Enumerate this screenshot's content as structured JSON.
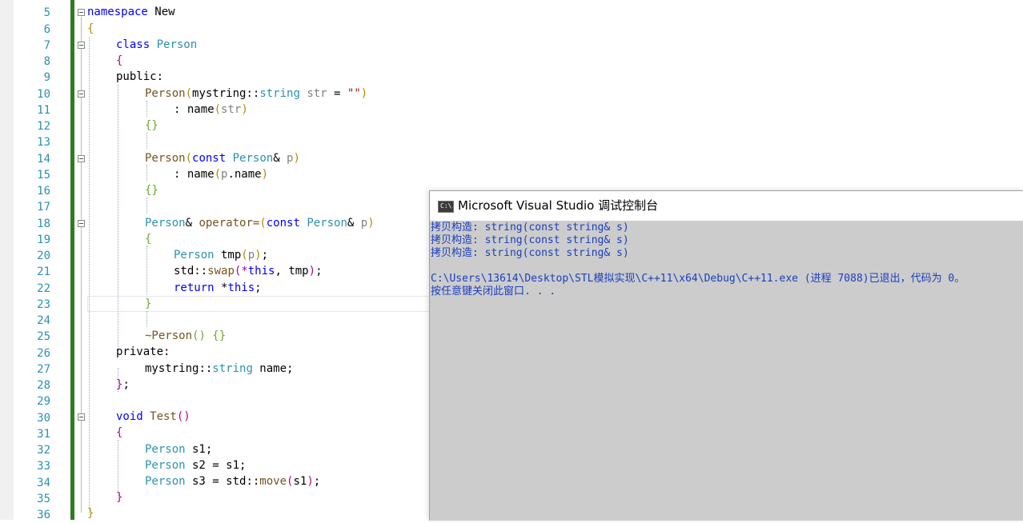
{
  "editor": {
    "line_numbers": [
      "5",
      "6",
      "7",
      "8",
      "9",
      "10",
      "11",
      "12",
      "13",
      "14",
      "15",
      "16",
      "17",
      "18",
      "19",
      "20",
      "21",
      "22",
      "23",
      "24",
      "25",
      "26",
      "27",
      "28",
      "29",
      "30",
      "31",
      "32",
      "33",
      "34",
      "35",
      "36"
    ],
    "code": {
      "l5_kw": "namespace",
      "l5_name": " New",
      "l6": "{",
      "l7_kw": "class",
      "l7_name": "Person",
      "l8": "{",
      "l9": "public:",
      "l10_fn": "Person",
      "l10_open": "(",
      "l10_ns": "mystring",
      "l10_sep": "::",
      "l10_ty": "string",
      "l10_param": " str",
      "l10_eq": " = ",
      "l10_str": "\"\"",
      "l10_close": ")",
      "l11_colon": ": name",
      "l11_open": "(",
      "l11_arg": "str",
      "l11_close": ")",
      "l12": "{}",
      "l14_fn": "Person",
      "l14_open": "(",
      "l14_kw": "const",
      "l14_ty": " Person",
      "l14_amp": "& ",
      "l14_p": "p",
      "l14_close": ")",
      "l15_colon": ": name",
      "l15_open": "(",
      "l15_arg": "p",
      "l15_dot": ".name",
      "l15_close": ")",
      "l16": "{}",
      "l18_ty": "Person",
      "l18_amp": "& ",
      "l18_op": "operator=",
      "l18_open": "(",
      "l18_kw": "const",
      "l18_ty2": " Person",
      "l18_amp2": "& ",
      "l18_p": "p",
      "l18_close": ")",
      "l19": "{",
      "l20_ty": "Person",
      "l20_var": " tmp",
      "l20_open": "(",
      "l20_p": "p",
      "l20_close": ")",
      "l20_semi": ";",
      "l21_ns": "std",
      "l21_sep": "::",
      "l21_fn": "swap",
      "l21_open": "(",
      "l21_star": "*",
      "l21_this": "this",
      "l21_comma": ", ",
      "l21_tmp": "tmp",
      "l21_close": ")",
      "l21_semi": ";",
      "l22_kw": "return",
      "l22_star": " *",
      "l22_this": "this",
      "l22_semi": ";",
      "l23": "}",
      "l25_fn": "~Person",
      "l25_paren": "()",
      "l25_brace": " {}",
      "l26": "private:",
      "l27_ns": "mystring",
      "l27_sep": "::",
      "l27_ty": "string",
      "l27_name": " name;",
      "l28_brace": "}",
      "l28_semi": ";",
      "l30_kw": "void",
      "l30_fn": " Test",
      "l30_paren": "()",
      "l31": "{",
      "l32_ty": "Person",
      "l32_var": " s1;",
      "l33_ty": "Person",
      "l33_var": " s2 = s1;",
      "l34_ty": "Person",
      "l34_var": " s3 = std",
      "l34_sep": "::",
      "l34_fn": "move",
      "l34_open": "(",
      "l34_arg": "s1",
      "l34_close": ")",
      "l34_semi": ";",
      "l35": "}",
      "l36": "}"
    }
  },
  "console": {
    "title": "Microsoft Visual Studio 调试控制台",
    "icon": "console-app-icon",
    "icon_text": "C:\\",
    "lines": [
      "拷贝构造: string(const string& s)",
      "拷贝构造: string(const string& s)",
      "拷贝构造: string(const string& s)",
      "",
      "C:\\Users\\13614\\Desktop\\STL模拟实现\\C++11\\x64\\Debug\\C++11.exe (进程 7088)已退出，代码为 0。",
      "按任意键关闭此窗口. . ."
    ]
  },
  "colors": {
    "keyword": "#0000ff",
    "type": "#2b91af",
    "function": "#74531f",
    "console_text": "#1a3fbf",
    "console_bg": "#cccccc",
    "change_bar": "#2d7d1e"
  }
}
